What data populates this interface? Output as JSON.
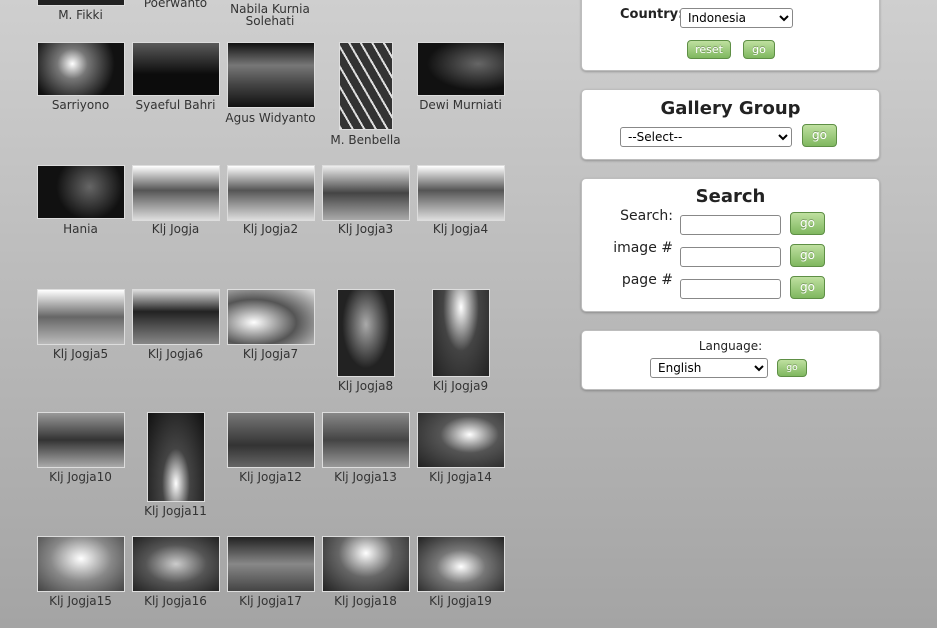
{
  "gallery": {
    "partial_row": [
      {
        "caption": "M. Fikki",
        "tone": "#222"
      },
      {
        "caption": "Poerwanto",
        "tone": "#333"
      },
      {
        "caption": "Nabila Kurnia Solehati",
        "tone": "#444"
      }
    ],
    "rows": [
      [
        {
          "caption": "Sarriyono",
          "tone": "#1a1a1a",
          "shape": "land"
        },
        {
          "caption": "Syaeful Bahri",
          "tone": "#0e0e0e",
          "shape": "land"
        },
        {
          "caption": "Agus Widyanto",
          "tone": "#2a2a2a",
          "shape": "tall-land"
        },
        {
          "caption": "M. Benbella",
          "tone": "#3a3a3a",
          "shape": "portrait"
        },
        {
          "caption": "Dewi Murniati",
          "tone": "#111",
          "shape": "land"
        }
      ],
      [
        {
          "caption": "Hania",
          "tone": "#151515",
          "shape": "land"
        },
        {
          "caption": "Klj Jogja",
          "tone": "#8a8a8a",
          "shape": "land"
        },
        {
          "caption": "Klj Jogja2",
          "tone": "#8a8a8a",
          "shape": "land"
        },
        {
          "caption": "Klj Jogja3",
          "tone": "#7a7a7a",
          "shape": "land"
        },
        {
          "caption": "Klj Jogja4",
          "tone": "#8a8a8a",
          "shape": "land"
        }
      ],
      [
        {
          "caption": "Klj Jogja5",
          "tone": "#7f7f7f",
          "shape": "land"
        },
        {
          "caption": "Klj Jogja6",
          "tone": "#555",
          "shape": "land"
        },
        {
          "caption": "Klj Jogja7",
          "tone": "#777",
          "shape": "land"
        },
        {
          "caption": "Klj Jogja8",
          "tone": "#333",
          "shape": "portrait"
        },
        {
          "caption": "Klj Jogja9",
          "tone": "#444",
          "shape": "portrait"
        }
      ],
      [
        {
          "caption": "Klj Jogja10",
          "tone": "#666",
          "shape": "land"
        },
        {
          "caption": "Klj Jogja11",
          "tone": "#2a2a2a",
          "shape": "portrait"
        },
        {
          "caption": "Klj Jogja12",
          "tone": "#555",
          "shape": "land"
        },
        {
          "caption": "Klj Jogja13",
          "tone": "#666",
          "shape": "land"
        },
        {
          "caption": "Klj Jogja14",
          "tone": "#555",
          "shape": "land"
        }
      ],
      [
        {
          "caption": "Klj Jogja15",
          "tone": "#999",
          "shape": "land"
        },
        {
          "caption": "Klj Jogja16",
          "tone": "#666",
          "shape": "land"
        },
        {
          "caption": "Klj Jogja17",
          "tone": "#555",
          "shape": "land"
        },
        {
          "caption": "Klj Jogja18",
          "tone": "#777",
          "shape": "land"
        },
        {
          "caption": "Klj Jogja19",
          "tone": "#666",
          "shape": "land"
        }
      ]
    ]
  },
  "country_panel": {
    "label": "Country:",
    "selected": "Indonesia",
    "reset_label": "reset",
    "go_label": "go"
  },
  "gallery_group": {
    "title": "Gallery Group",
    "selected": "--Select--",
    "go_label": "go"
  },
  "search": {
    "title": "Search",
    "search_label": "Search:",
    "image_label": "image #",
    "page_label": "page #",
    "go_label": "go"
  },
  "language": {
    "label": "Language:",
    "selected": "English",
    "go_label": "go"
  }
}
